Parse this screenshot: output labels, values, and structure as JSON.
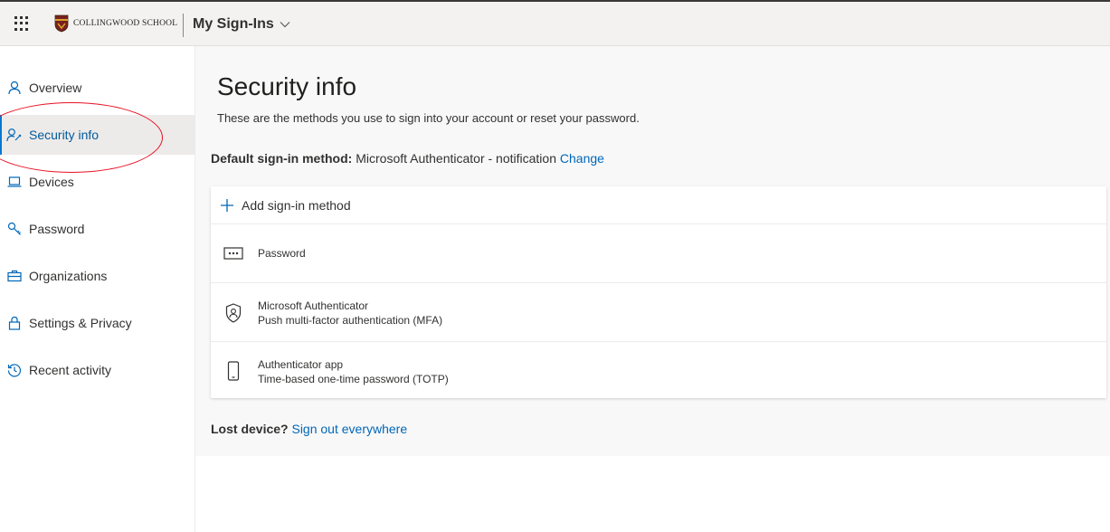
{
  "topbar": {
    "logo_text": "COLLINGWOOD SCHOOL",
    "app_title": "My Sign-Ins"
  },
  "sidebar": {
    "items": [
      {
        "label": "Overview",
        "icon": "person-icon"
      },
      {
        "label": "Security info",
        "icon": "person-key-icon",
        "active": true
      },
      {
        "label": "Devices",
        "icon": "laptop-icon"
      },
      {
        "label": "Password",
        "icon": "key-icon"
      },
      {
        "label": "Organizations",
        "icon": "briefcase-icon"
      },
      {
        "label": "Settings & Privacy",
        "icon": "lock-icon"
      },
      {
        "label": "Recent activity",
        "icon": "history-icon"
      }
    ]
  },
  "main": {
    "title": "Security info",
    "subtitle": "These are the methods you use to sign into your account or reset your password.",
    "default_method": {
      "label": "Default sign-in method:",
      "value": "Microsoft Authenticator - notification",
      "change_link": "Change"
    },
    "add_method_label": "Add sign-in method",
    "methods": [
      {
        "title": "Password",
        "subtitle": "",
        "icon": "password-dots-icon"
      },
      {
        "title": "Microsoft Authenticator",
        "subtitle": "Push multi-factor authentication (MFA)",
        "icon": "authenticator-icon"
      },
      {
        "title": "Authenticator app",
        "subtitle": "Time-based one-time password (TOTP)",
        "icon": "phone-icon"
      }
    ],
    "lost_device": {
      "label": "Lost device?",
      "link": "Sign out everywhere"
    }
  },
  "colors": {
    "accent": "#0078d4",
    "link": "#0067b8",
    "annotation": "#e81123"
  }
}
